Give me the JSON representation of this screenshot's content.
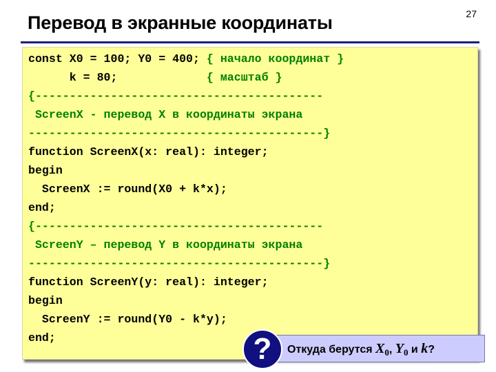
{
  "slide": {
    "number": "27",
    "title": "Перевод в экранные координаты"
  },
  "code": {
    "lines": [
      {
        "code": "const X0 = 100; Y0 = 400; ",
        "comment": "{ начало координат }"
      },
      {
        "code": "      k = 80;             ",
        "comment": "{ масштаб }"
      },
      {
        "code": "",
        "comment": "{------------------------------------------"
      },
      {
        "code": "",
        "comment": " ScreenX - перевод X в координаты экрана"
      },
      {
        "code": "",
        "comment": "-------------------------------------------}"
      },
      {
        "code": "function ScreenX(x: real): integer;",
        "comment": ""
      },
      {
        "code": "begin",
        "comment": ""
      },
      {
        "code": "  ScreenX := round(X0 + k*x);",
        "comment": ""
      },
      {
        "code": "end;",
        "comment": ""
      },
      {
        "code": "",
        "comment": "{------------------------------------------"
      },
      {
        "code": "",
        "comment": " ScreenY – перевод Y в координаты экрана"
      },
      {
        "code": "",
        "comment": "-------------------------------------------}"
      },
      {
        "code": "function ScreenY(y: real): integer;",
        "comment": ""
      },
      {
        "code": "begin",
        "comment": ""
      },
      {
        "code": "  ScreenY := round(Y0 - k*y);",
        "comment": ""
      },
      {
        "code": "end;",
        "comment": ""
      }
    ]
  },
  "callout": {
    "icon": "question-mark-icon",
    "icon_glyph": "?",
    "prefix": "Откуда берутся ",
    "var1": "X",
    "sub1": "0",
    "sep1": ", ",
    "var2": "Y",
    "sub2": "0",
    "sep2": " и ",
    "var3": "k",
    "suffix": "?"
  },
  "colors": {
    "code_background": "#ffff99",
    "comment": "#008000",
    "title_rule": "#1c1c7c",
    "callout_background": "#ccccff",
    "badge": "#101080"
  }
}
